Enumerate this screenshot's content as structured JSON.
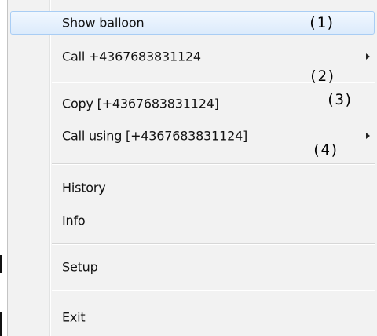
{
  "menu": {
    "items": [
      {
        "label": "Show balloon",
        "highlighted": true,
        "submenu": false
      },
      {
        "label": "Call +4367683831124",
        "highlighted": false,
        "submenu": true
      },
      {
        "label": "Copy  [+4367683831124]",
        "highlighted": false,
        "submenu": false
      },
      {
        "label": "Call using [+4367683831124]",
        "highlighted": false,
        "submenu": true
      },
      {
        "label": "History",
        "highlighted": false,
        "submenu": false
      },
      {
        "label": "Info",
        "highlighted": false,
        "submenu": false
      },
      {
        "label": "Setup",
        "highlighted": false,
        "submenu": false
      },
      {
        "label": "Exit",
        "highlighted": false,
        "submenu": false
      }
    ]
  },
  "annotations": [
    "(1)",
    "(2)",
    "(3)",
    "(4)"
  ],
  "icons": {
    "submenu_arrow": "submenu-arrow-icon"
  },
  "colors": {
    "menu_background": "#f2f2f2",
    "highlight_border": "#a9cdf4",
    "highlight_fill": "#dcebfc",
    "text": "#111111"
  }
}
